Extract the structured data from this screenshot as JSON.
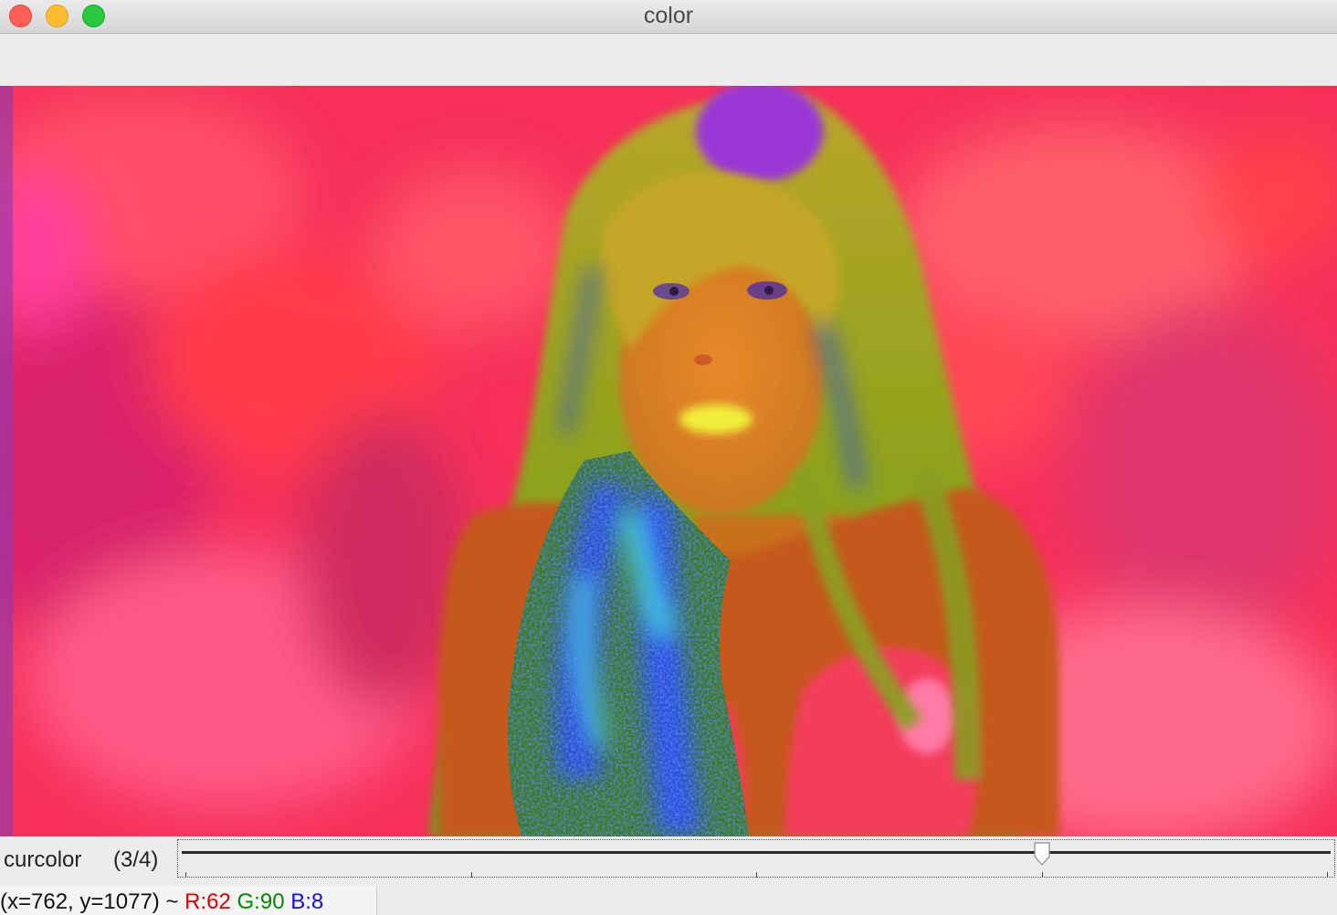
{
  "window": {
    "title": "color"
  },
  "trackbar": {
    "label": "curcolor",
    "value_text": "(3/4)",
    "value": 3,
    "max": 4
  },
  "status": {
    "coords": "(x=762, y=1077) ~",
    "r": "R:62",
    "g": "G:90",
    "b": "B:8"
  },
  "colors": {
    "close": "#fe5f57",
    "minimize": "#febc2e",
    "zoom": "#28c840",
    "status_r": "#e00000",
    "status_g": "#008a00",
    "status_b": "#1010e6"
  }
}
